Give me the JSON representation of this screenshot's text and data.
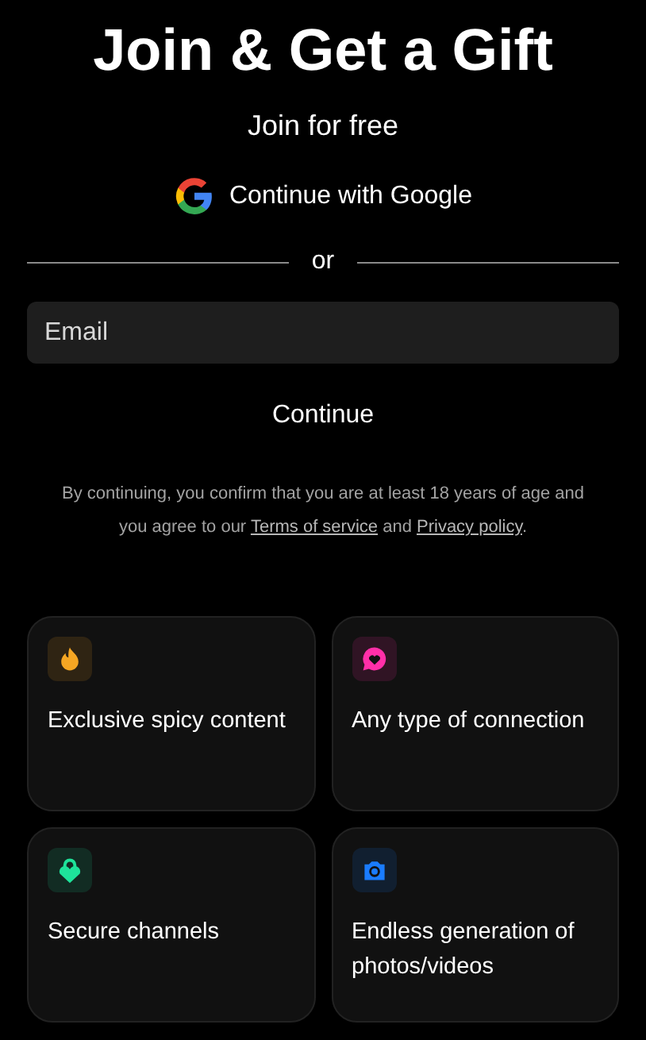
{
  "title": "Join & Get a Gift",
  "subtitle": "Join for free",
  "google_button": {
    "label": "Continue with Google"
  },
  "divider": {
    "label": "or"
  },
  "email_field": {
    "placeholder": "Email"
  },
  "continue_button": {
    "label": "Continue"
  },
  "legal": {
    "text_before": "By continuing, you confirm that you are at least 18 years of age and you agree to our ",
    "terms_link": "Terms of service",
    "text_middle": " and ",
    "privacy_link": "Privacy policy",
    "text_after": "."
  },
  "features": [
    {
      "kind": "flame",
      "color": "#f5a623",
      "label": "Exclusive spicy content"
    },
    {
      "kind": "chat",
      "color": "#ff2fa8",
      "label": "Any type of connection"
    },
    {
      "kind": "lock",
      "color": "#1ee39a",
      "label": "Secure channels"
    },
    {
      "kind": "camera",
      "color": "#1a7cff",
      "label": "Endless generation of photos/videos"
    }
  ]
}
